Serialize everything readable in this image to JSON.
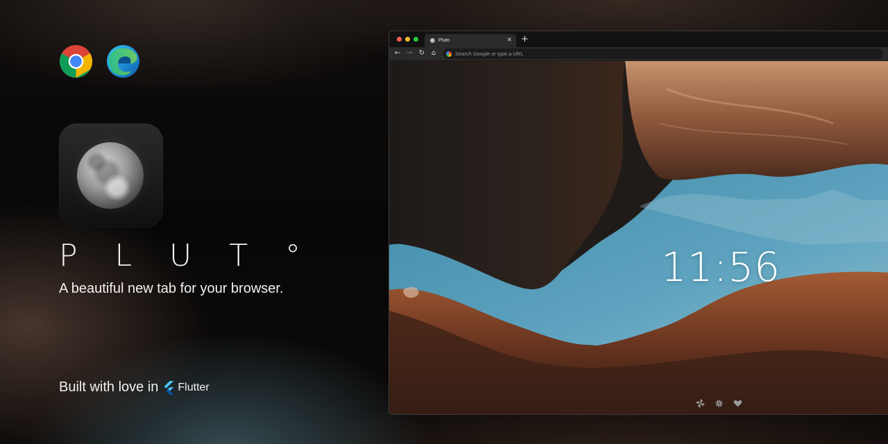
{
  "promo": {
    "wordmark": "P L U T °",
    "tagline": "A beautiful new tab for your browser.",
    "built_with": "Built with love in",
    "framework": "Flutter",
    "browser_icons": [
      "chrome-icon",
      "edge-icon"
    ]
  },
  "browser": {
    "tab_title": "Pluto",
    "tab_close": "✕",
    "new_tab": "+",
    "omnibox_placeholder": "Search Google or type a URL",
    "nav": {
      "back": "←",
      "forward": "→",
      "reload": "↻",
      "home": "⌂"
    }
  },
  "newtab": {
    "time": "11:56",
    "actions": [
      "pinwheel-icon",
      "gear-icon",
      "heart-icon"
    ]
  },
  "colors": {
    "traffic_red": "#ff5f57",
    "traffic_yellow": "#febc2e",
    "traffic_green": "#28c840",
    "flutter_blue": "#47c5fb",
    "sky": "#4f97b5",
    "rock": "#8a4b2e"
  }
}
